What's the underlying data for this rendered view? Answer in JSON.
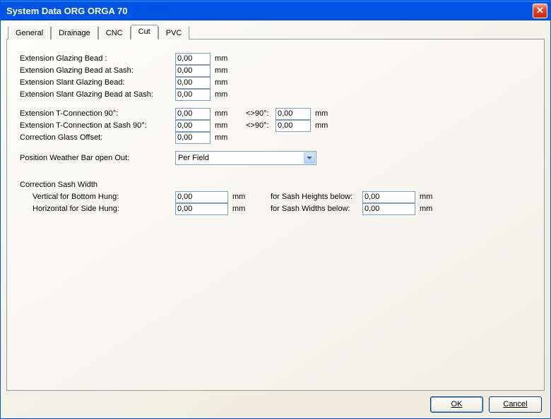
{
  "window": {
    "title": "System Data ORG ORGA 70"
  },
  "tabs": {
    "items": [
      {
        "label": "General"
      },
      {
        "label": "Drainage"
      },
      {
        "label": "CNC"
      },
      {
        "label": "Cut"
      },
      {
        "label": "PVC"
      }
    ],
    "active_index": 3
  },
  "units": {
    "mm": "mm"
  },
  "cut": {
    "rows1": [
      {
        "label": "Extension Glazing Bead :",
        "value": "0,00"
      },
      {
        "label": "Extension Glazing Bead at Sash:",
        "value": "0,00"
      },
      {
        "label": "Extension Slant Glazing Bead:",
        "value": "0,00"
      },
      {
        "label": "Extension Slant Glazing Bead at Sash:",
        "value": "0,00"
      }
    ],
    "tconn": [
      {
        "label": "Extension T-Connection 90°:",
        "value": "0,00",
        "mid": "<>90°:",
        "value2": "0,00"
      },
      {
        "label": "Extension T-Connection at Sash 90°:",
        "value": "0,00",
        "mid": "<>90°:",
        "value2": "0,00"
      }
    ],
    "glass_offset": {
      "label": "Correction Glass Offset:",
      "value": "0,00"
    },
    "weather": {
      "label": "Position Weather Bar open Out:",
      "value": "Per Field"
    },
    "sash": {
      "title": "Correction Sash Width",
      "rows": [
        {
          "label": "Vertical for Bottom Hung:",
          "value": "0,00",
          "for_label": "for Sash Heights below:",
          "for_value": "0,00"
        },
        {
          "label": "Horizontal for Side Hung:",
          "value": "0,00",
          "for_label": "for Sash Widths below:",
          "for_value": "0,00"
        }
      ]
    }
  },
  "buttons": {
    "ok": "OK",
    "cancel": "Cancel"
  }
}
